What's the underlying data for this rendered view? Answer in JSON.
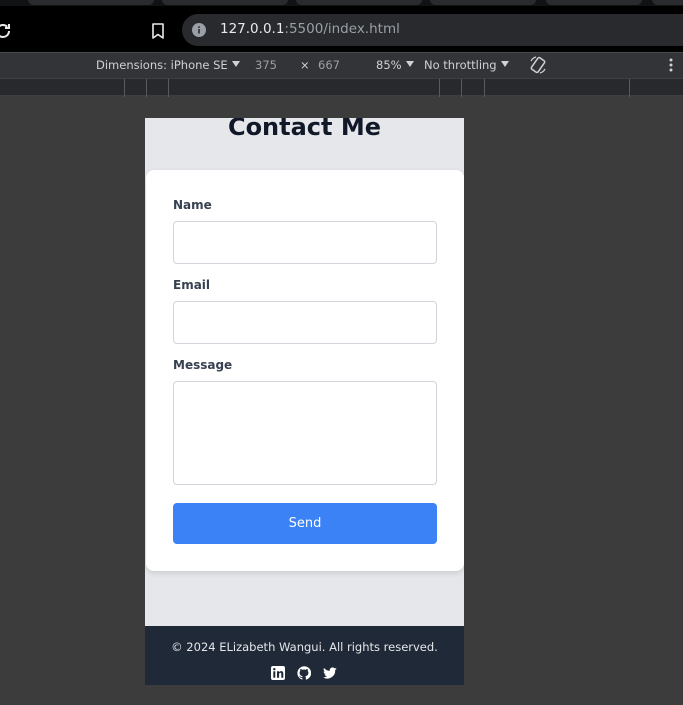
{
  "browser": {
    "url_host": "127.0.0.1",
    "url_rest": ":5500/index.html"
  },
  "devtools": {
    "dimensions_label": "Dimensions: iPhone SE",
    "width": "375",
    "times": "×",
    "height": "667",
    "zoom": "85%",
    "throttling": "No throttling"
  },
  "page": {
    "title": "Contact Me",
    "form": {
      "name_label": "Name",
      "name_value": "",
      "email_label": "Email",
      "email_value": "",
      "message_label": "Message",
      "message_value": "",
      "send_label": "Send"
    },
    "footer": {
      "copyright": "© 2024 ELizabeth Wangui. All rights reserved.",
      "icons": [
        "linkedin-icon",
        "github-icon",
        "twitter-icon"
      ]
    }
  },
  "colors": {
    "accent": "#3b82f6",
    "footer_bg": "#1f2937",
    "page_bg": "#e5e7eb"
  }
}
